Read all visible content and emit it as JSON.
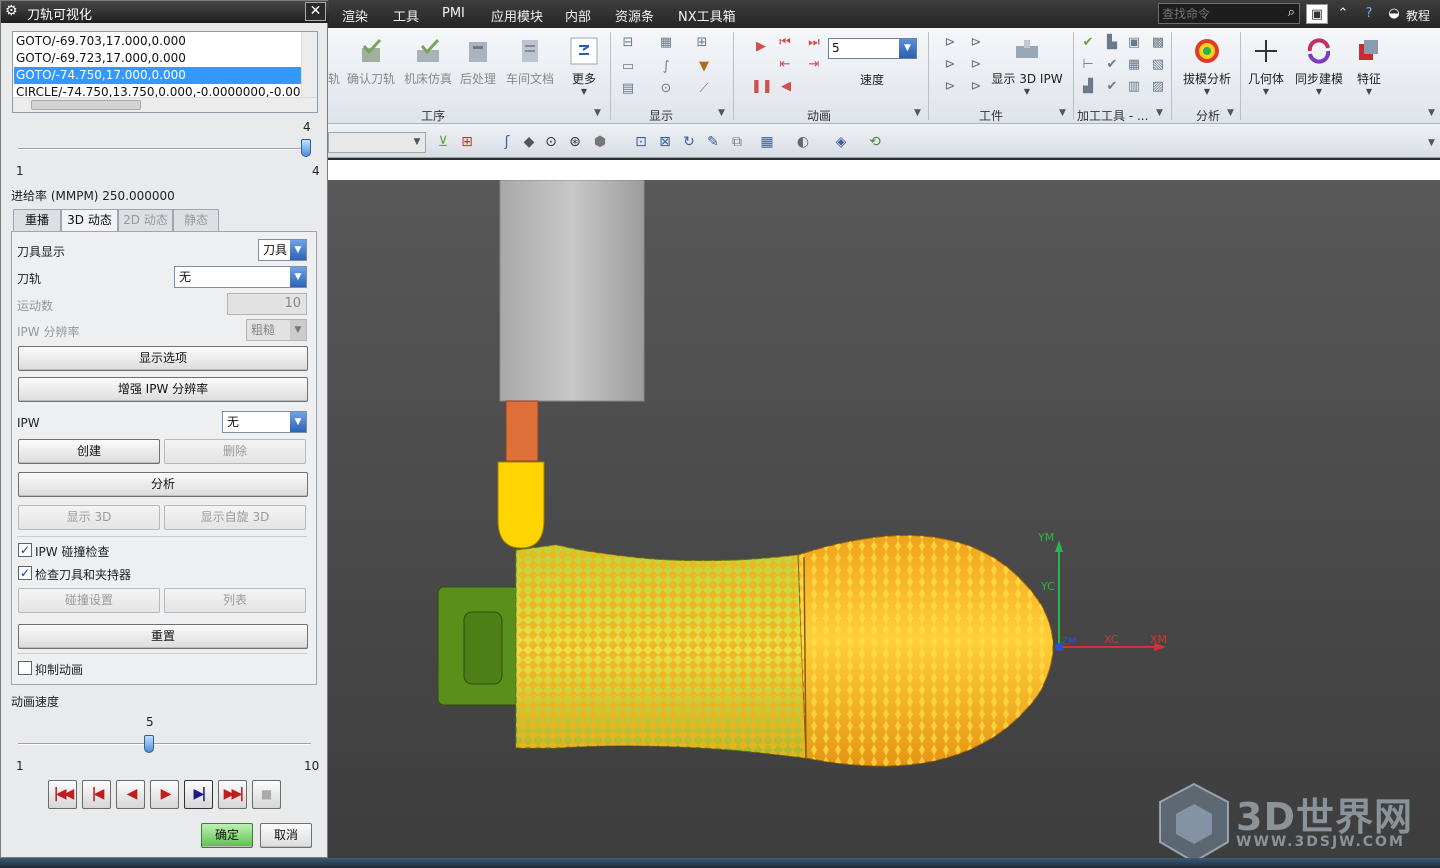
{
  "menubar": {
    "items": [
      "渲染",
      "工具",
      "PMI",
      "应用模块",
      "内部",
      "资源条",
      "NX工具箱"
    ],
    "search_placeholder": "查找命令",
    "help_label": "教程"
  },
  "ribbon": {
    "operations": [
      "确认刀轨",
      "机床仿真",
      "后处理",
      "车间文档"
    ],
    "partial_left": "轨",
    "more": "更多",
    "group_ops": "工序",
    "group_display": "显示",
    "group_animation": "动画",
    "speed_value": "5",
    "speed_label": "速度",
    "show_ipw": "显示 3D IPW",
    "group_workpiece": "工件",
    "group_machining_tools": "加工工具 - ...",
    "draft_analysis": "拔模分析",
    "group_analysis": "分析",
    "geometry": "几何体",
    "sync_modeling": "同步建模",
    "feature": "特征"
  },
  "dialog": {
    "title": "刀轨可视化",
    "list_rows": [
      "GOTO/-69.703,17.000,0.000",
      "GOTO/-69.723,17.000,0.000",
      "GOTO/-74.750,17.000,0.000",
      "CIRCLE/-74.750,13.750,0.000,-0.0000000,-0.0000000"
    ],
    "selected_row": 2,
    "top_slider": {
      "min": "1",
      "max": "4",
      "value_label": "4",
      "position": 1.0
    },
    "feed_rate": "进给率 (MMPM) 250.000000",
    "tabs": [
      "重播",
      "3D 动态",
      "2D 动态",
      "静态"
    ],
    "active_tab": 1,
    "tool_display_label": "刀具显示",
    "tool_display_value": "刀具",
    "path_label": "刀轨",
    "path_value": "无",
    "motion_count_label": "运动数",
    "motion_count_value": "10",
    "ipw_res_label": "IPW 分辨率",
    "ipw_res_value": "粗糙",
    "display_options": "显示选项",
    "enhance_ipw": "增强 IPW 分辨率",
    "ipw_label": "IPW",
    "ipw_value": "无",
    "create": "创建",
    "delete": "删除",
    "analyze": "分析",
    "show_3d": "显示 3D",
    "show_spin_3d": "显示自旋 3D",
    "chk_ipw_collision": "IPW 碰撞检查",
    "chk_tool_holder": "检查刀具和夹持器",
    "collision_settings": "碰撞设置",
    "list_btn": "列表",
    "reset": "重置",
    "chk_suppress_anim": "抑制动画",
    "anim_speed_label": "动画速度",
    "speed_slider": {
      "min": "1",
      "max": "10",
      "value_label": "5",
      "position": 0.444
    },
    "ok": "确定",
    "cancel": "取消"
  },
  "viewport": {
    "axis_labels": {
      "ym": "YM",
      "yc": "YC",
      "xc": "XC",
      "xm": "XM",
      "origin": "ZM"
    },
    "watermark_title": "3D世界网",
    "watermark_url": "WWW.3DSJW.COM"
  },
  "colors": {
    "part_orange": "#f0a21a",
    "part_green": "#88c020",
    "fixture_green": "#5a8f1c",
    "tool_yellow": "#ffd400",
    "holder_gray": "#b9b9b9",
    "collet_orange": "#e0703a",
    "selection_blue": "#3399ff"
  }
}
